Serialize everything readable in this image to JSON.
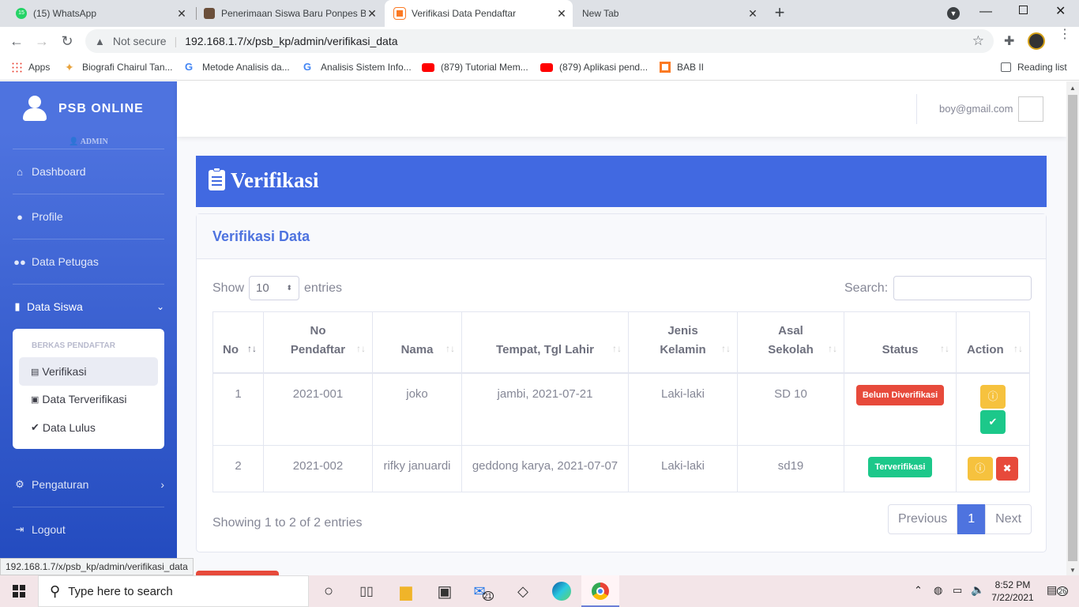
{
  "browser": {
    "tabs": [
      {
        "title": "(15) WhatsApp",
        "badge": "15"
      },
      {
        "title": "Penerimaan Siswa Baru Ponpes B"
      },
      {
        "title": "Verifikasi Data Pendaftar"
      },
      {
        "title": "New Tab"
      }
    ],
    "security": "Not secure",
    "url": "192.168.1.7/x/psb_kp/admin/verifikasi_data",
    "bookmarks": [
      "Apps",
      "Biografi Chairul Tan...",
      "Metode Analisis da...",
      "Analisis Sistem Info...",
      "(879) Tutorial Mem...",
      "(879) Aplikasi pend...",
      "BAB II"
    ],
    "reading_list": "Reading list",
    "status_url": "192.168.1.7/x/psb_kp/admin/verifikasi_data"
  },
  "sidebar": {
    "brand": "PSB ONLINE",
    "role": "ADMIN",
    "items": {
      "dashboard": "Dashboard",
      "profile": "Profile",
      "petugas": "Data Petugas",
      "siswa": "Data Siswa",
      "pengaturan": "Pengaturan",
      "logout": "Logout"
    },
    "submenu": {
      "header": "BERKAS PENDAFTAR",
      "items": [
        "Verifikasi",
        "Data Terverifikasi",
        "Data Lulus"
      ]
    }
  },
  "topbar": {
    "user_email": "boy@gmail.com"
  },
  "page": {
    "title": "Verifikasi",
    "card_title": "Verifikasi Data",
    "show_label": "Show",
    "entries_value": "10",
    "entries_label": "entries",
    "search_label": "Search:",
    "search_value": "",
    "columns": [
      [
        "No"
      ],
      [
        "No",
        "Pendaftar"
      ],
      [
        "Nama"
      ],
      [
        "Tempat, Tgl Lahir"
      ],
      [
        "Jenis",
        "Kelamin"
      ],
      [
        "Asal",
        "Sekolah"
      ],
      [
        "Status"
      ],
      [
        "Action"
      ]
    ],
    "rows": [
      {
        "no": "1",
        "no_pendaftar": "2021-001",
        "nama": "joko",
        "ttl": "jambi, 2021-07-21",
        "jk": "Laki-laki",
        "sekolah": "SD 10",
        "status": "Belum Diverifikasi"
      },
      {
        "no": "2",
        "no_pendaftar": "2021-002",
        "nama": "rifky januardi",
        "ttl": "geddong karya, 2021-07-07",
        "jk": "Laki-laki",
        "sekolah": "sd19",
        "status": "Terverifikasi"
      }
    ],
    "info": "Showing 1 to 2 of 2 entries",
    "pager": {
      "prev": "Previous",
      "current": "1",
      "next": "Next"
    }
  },
  "taskbar": {
    "search_placeholder": "Type here to search",
    "time": "8:52 PM",
    "date": "7/22/2021",
    "mail_badge": "21",
    "notif_badge": "26"
  },
  "colors": {
    "primary": "#4e73df",
    "banner": "#4169e1",
    "danger": "#e74a3b",
    "success": "#1cc88a",
    "warning": "#f6c23e"
  }
}
